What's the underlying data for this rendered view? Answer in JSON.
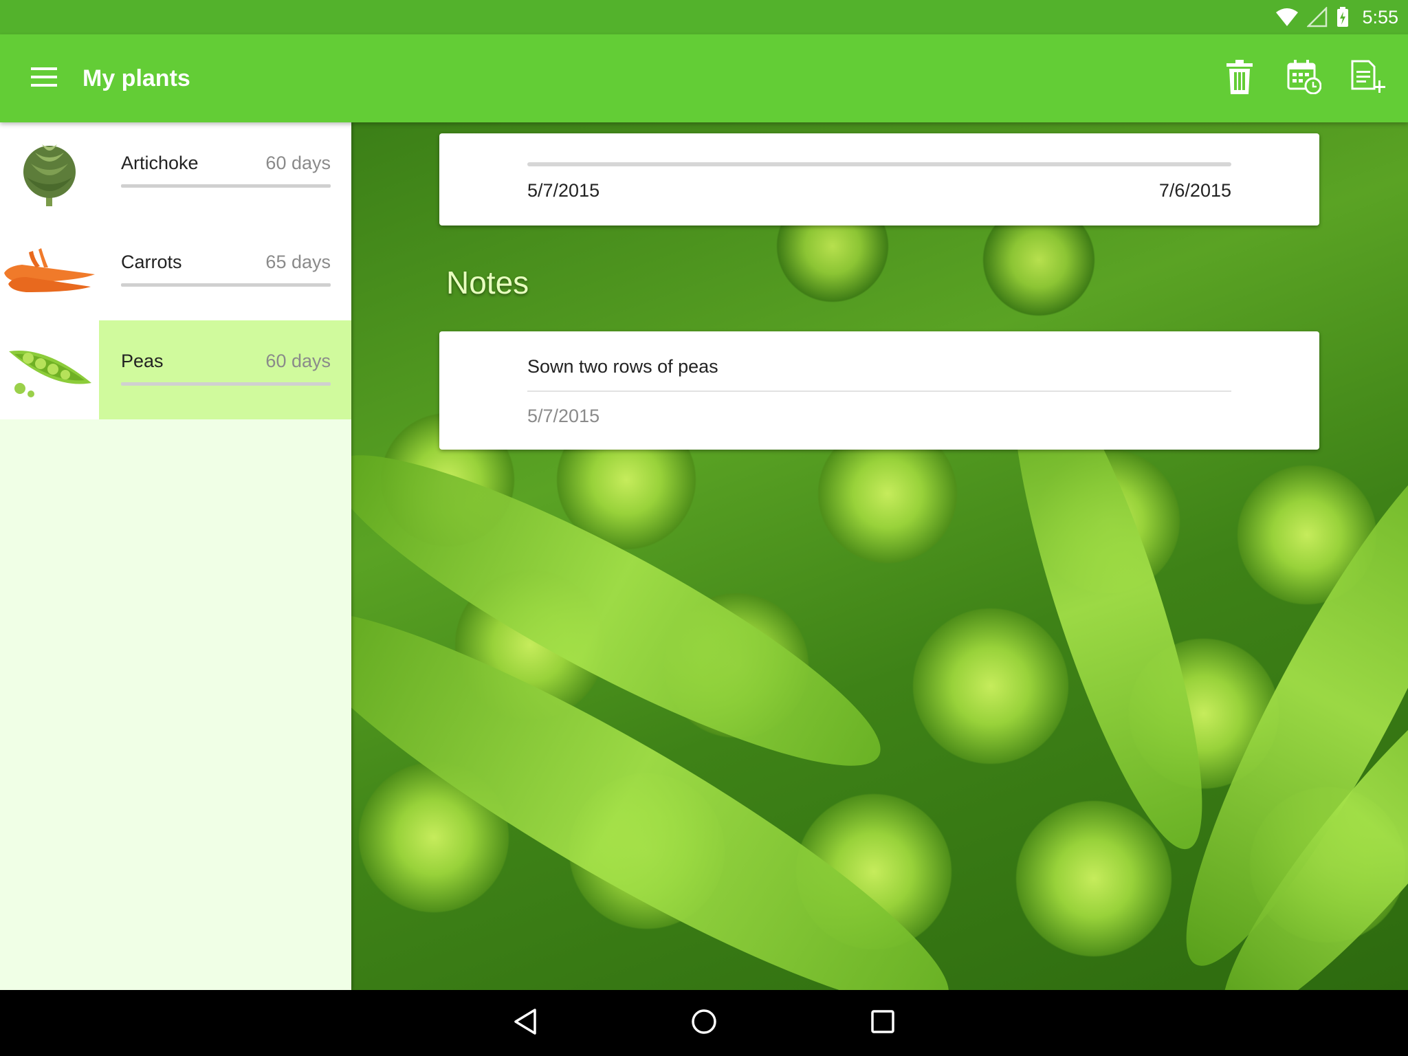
{
  "status_bar": {
    "time": "5:55",
    "icons": [
      "wifi-icon",
      "cellular-signal-icon",
      "battery-charging-icon"
    ]
  },
  "app_bar": {
    "title": "My plants",
    "menu_icon": "hamburger-menu-icon",
    "actions": [
      "delete-icon",
      "calendar-schedule-icon",
      "add-note-icon"
    ],
    "color": "#63cd36"
  },
  "plants": [
    {
      "name": "Artichoke",
      "days": "60 days",
      "icon": "artichoke-thumbnail",
      "selected": false
    },
    {
      "name": "Carrots",
      "days": "65 days",
      "icon": "carrots-thumbnail",
      "selected": false
    },
    {
      "name": "Peas",
      "days": "60 days",
      "icon": "peas-thumbnail",
      "selected": true
    }
  ],
  "timeline": {
    "start_date": "5/7/2015",
    "end_date": "7/6/2015",
    "progress": 0
  },
  "notes": {
    "heading": "Notes",
    "items": [
      {
        "text": "Sown two rows of peas",
        "date": "5/7/2015"
      }
    ]
  },
  "nav_bar": {
    "buttons": [
      "back-icon",
      "home-icon",
      "recents-icon"
    ]
  },
  "colors": {
    "accent": "#63cd36",
    "status_bar": "#53b22c",
    "selected_row": "#d0fa9d",
    "sidebar_bg": "#f0ffe6"
  }
}
